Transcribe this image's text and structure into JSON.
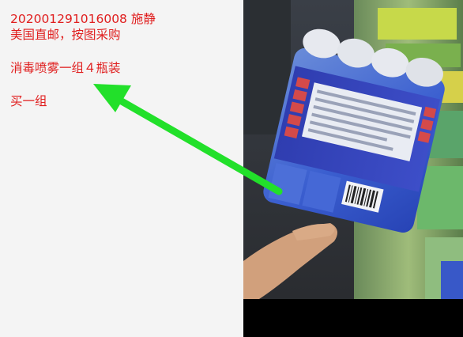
{
  "note": {
    "line1": "202001291016008   施静",
    "line2": "美国直邮，按图采购",
    "line3": "消毒喷雾一组４瓶装",
    "line4": "买一组"
  },
  "colors": {
    "note_text": "#e01e1e",
    "arrow": "#22e02a",
    "panel_bg": "#f4f4f4",
    "photo_letterbox": "#000000"
  },
  "photo": {
    "description_icon": "product-photo"
  }
}
